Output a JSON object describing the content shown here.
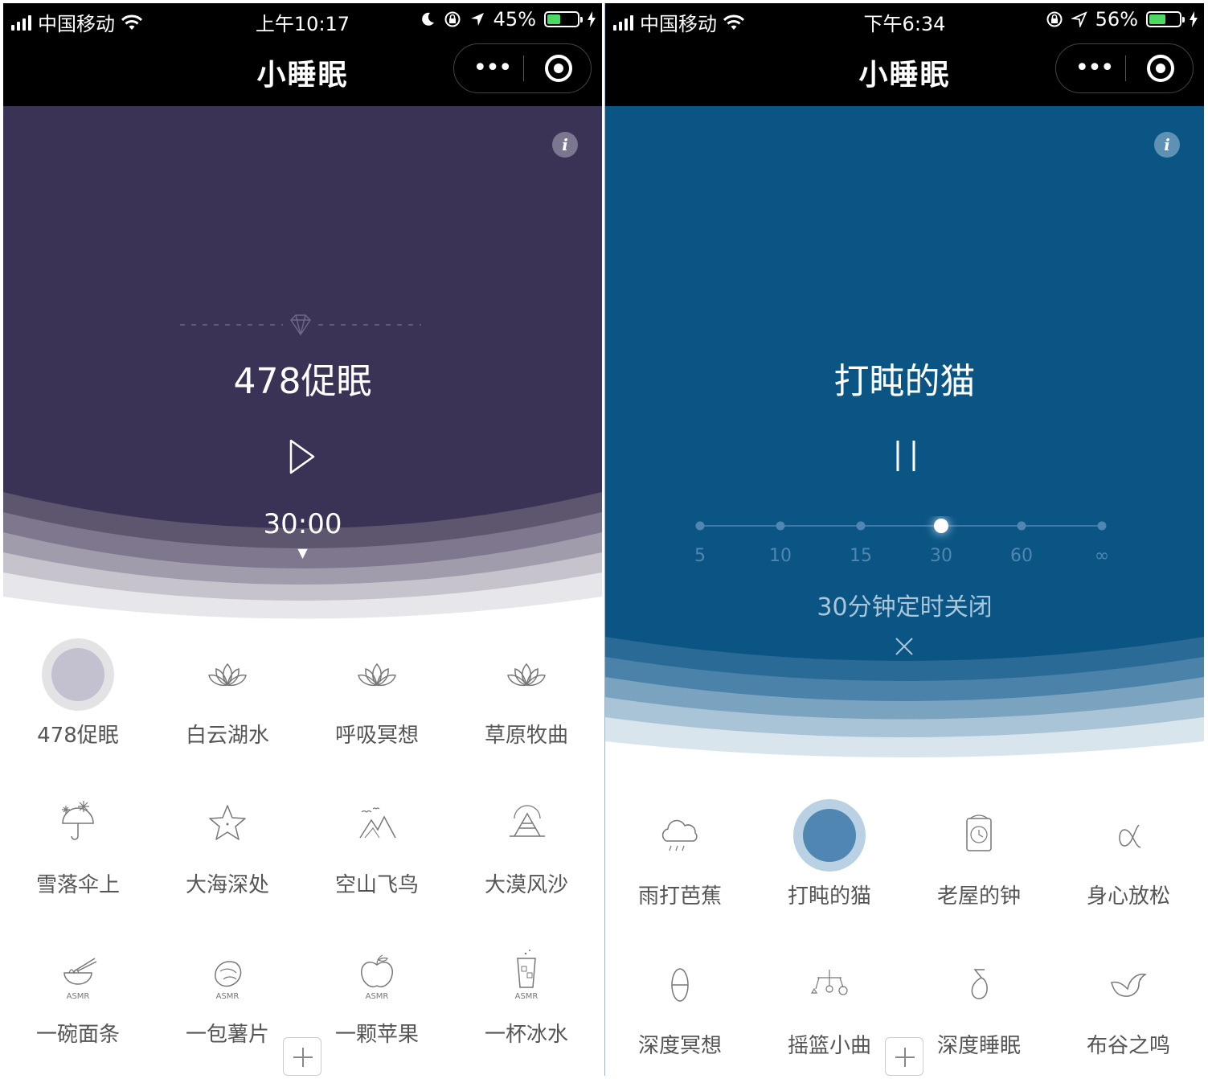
{
  "left": {
    "status": {
      "carrier": "中国移动",
      "time": "上午10:17",
      "battery": "45%",
      "battery_level": 0.45
    },
    "title": "小睡眠",
    "capsule_more": "•••",
    "now_playing": "478促眠",
    "timer": "30:00",
    "timer_arrow": "▼",
    "grid": [
      {
        "label": "478促眠",
        "icon": "selected-circle",
        "selected": true
      },
      {
        "label": "白云湖水",
        "icon": "lotus-icon"
      },
      {
        "label": "呼吸冥想",
        "icon": "lotus-icon"
      },
      {
        "label": "草原牧曲",
        "icon": "lotus-icon"
      },
      {
        "label": "雪落伞上",
        "icon": "snow-umbrella-icon"
      },
      {
        "label": "大海深处",
        "icon": "starfish-icon"
      },
      {
        "label": "空山飞鸟",
        "icon": "mountain-bird-icon"
      },
      {
        "label": "大漠风沙",
        "icon": "desert-icon"
      },
      {
        "label": "一碗面条",
        "icon": "noodle-bowl-icon",
        "badge": "ASMR"
      },
      {
        "label": "一包薯片",
        "icon": "chips-icon",
        "badge": "ASMR"
      },
      {
        "label": "一颗苹果",
        "icon": "apple-icon",
        "badge": "ASMR"
      },
      {
        "label": "一杯冰水",
        "icon": "ice-water-icon",
        "badge": "ASMR"
      }
    ],
    "colors": {
      "hero": "#3b3355",
      "selected_outer": "#e3e3e6",
      "selected_inner": "#c3c1cf"
    }
  },
  "right": {
    "status": {
      "carrier": "中国移动",
      "time": "下午6:34",
      "battery": "56%",
      "battery_level": 0.56
    },
    "title": "小睡眠",
    "capsule_more": "•••",
    "now_playing": "打盹的猫",
    "timer_options": [
      "5",
      "10",
      "15",
      "30",
      "60",
      "∞"
    ],
    "timer_selected": "30",
    "timer_desc": "30分钟定时关闭",
    "grid": [
      {
        "label": "雨打芭蕉",
        "icon": "rain-cloud-icon"
      },
      {
        "label": "打盹的猫",
        "icon": "selected-circle",
        "selected": true
      },
      {
        "label": "老屋的钟",
        "icon": "clock-icon"
      },
      {
        "label": "身心放松",
        "icon": "alpha-icon"
      },
      {
        "label": "深度冥想",
        "icon": "theta-icon"
      },
      {
        "label": "摇篮小曲",
        "icon": "mobile-toy-icon"
      },
      {
        "label": "深度睡眠",
        "icon": "delta-icon"
      },
      {
        "label": "布谷之鸣",
        "icon": "bird-icon"
      }
    ],
    "colors": {
      "hero": "#0b5584",
      "selected_outer": "#b9d1e2",
      "selected_inner": "#4f87b2"
    }
  }
}
